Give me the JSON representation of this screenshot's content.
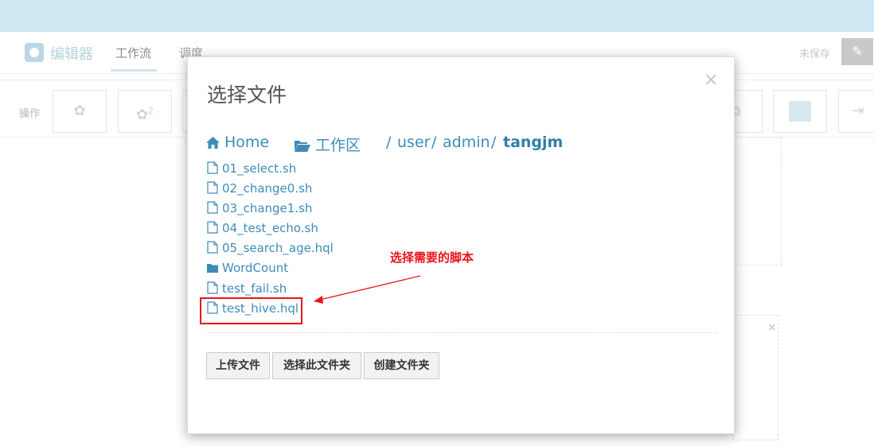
{
  "nav": {
    "brand": "编辑器",
    "tabs": [
      "工作流",
      "调度"
    ],
    "unsaved": "未保存",
    "edit_icon": "pencil-icon"
  },
  "toolbar": {
    "label": "操作",
    "badge": "2"
  },
  "modal": {
    "title": "选择文件",
    "close": "×",
    "breadcrumb": {
      "home": "Home",
      "workspace": "工作区",
      "separator": "/",
      "parts": [
        "user",
        "admin"
      ],
      "current": "tangjm"
    },
    "files": [
      {
        "name": "01_select.sh",
        "type": "file"
      },
      {
        "name": "02_change0.sh",
        "type": "file"
      },
      {
        "name": "03_change1.sh",
        "type": "file"
      },
      {
        "name": "04_test_echo.sh",
        "type": "file"
      },
      {
        "name": "05_search_age.hql",
        "type": "file"
      },
      {
        "name": "WordCount",
        "type": "folder"
      },
      {
        "name": "test_fail.sh",
        "type": "file"
      },
      {
        "name": "test_hive.hql",
        "type": "file"
      }
    ],
    "buttons": {
      "upload": "上传文件",
      "select_folder": "选择此文件夹",
      "create_folder": "创建文件夹"
    }
  },
  "annotation": {
    "text": "选择需要的脚本",
    "color": "#e8141a"
  },
  "background_close": "×",
  "colors": {
    "link": "#3d8cb8",
    "topbar": "#cfe8f3"
  }
}
